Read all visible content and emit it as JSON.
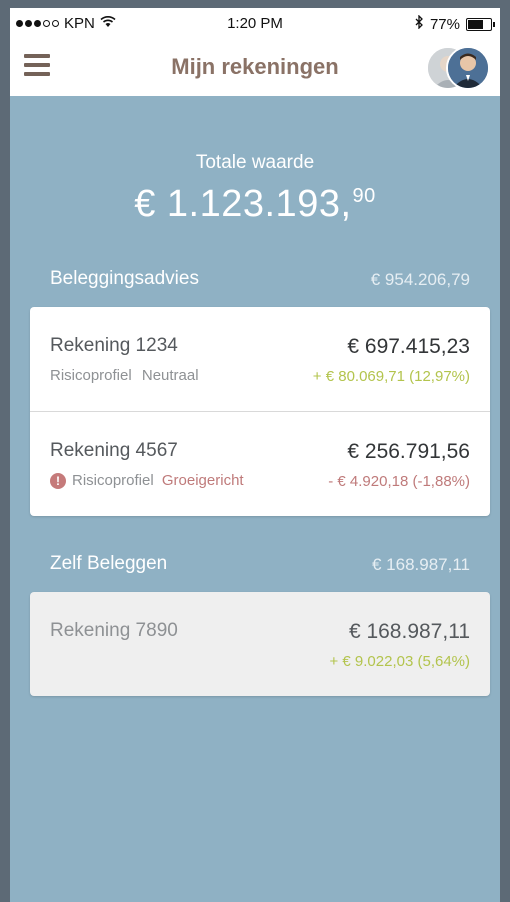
{
  "status_bar": {
    "carrier": "KPN",
    "time": "1:20 PM",
    "battery": "77%",
    "battery_level": 0.77
  },
  "nav": {
    "title": "Mijn rekeningen"
  },
  "total": {
    "label": "Totale waarde",
    "value_main": "€ 1.123.193,",
    "value_cents": "90"
  },
  "sections": [
    {
      "title": "Beleggingsadvies",
      "total": "€ 954.206,79",
      "accounts": [
        {
          "name": "Rekening 1234",
          "value": "€ 697.415,23",
          "profile_prefix": "Risicoprofiel",
          "profile_name": "Neutraal",
          "change": "+ € 80.069,71 (12,97%)"
        },
        {
          "name": "Rekening 4567",
          "value": "€ 256.791,56",
          "profile_prefix": "Risicoprofiel",
          "profile_name": "Groeigericht",
          "change": "- € 4.920,18 (-1,88%)"
        }
      ]
    },
    {
      "title": "Zelf Beleggen",
      "total": "€ 168.987,11",
      "accounts": [
        {
          "name": "Rekening 7890",
          "value": "€ 168.987,11",
          "change": "+ € 9.022,03 (5,64%)"
        }
      ]
    }
  ],
  "colors": {
    "background": "#8fb1c4",
    "positive": "#b3c44d",
    "negative": "#bf7a7a",
    "title": "#8a7266"
  }
}
